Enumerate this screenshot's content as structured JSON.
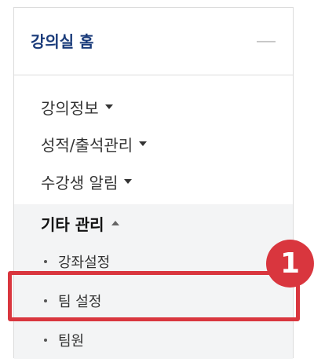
{
  "panel": {
    "title": "강의실 홈"
  },
  "menu": [
    {
      "label": "강의정보"
    },
    {
      "label": "성적/출석관리"
    },
    {
      "label": "수강생 알림"
    },
    {
      "label": "기타 관리"
    }
  ],
  "submenu": [
    {
      "label": "강좌설정"
    },
    {
      "label": "팀 설정"
    },
    {
      "label": "팀원"
    }
  ],
  "callout": {
    "number": "1"
  },
  "colors": {
    "title": "#1a3b7a",
    "highlight": "#d9363e",
    "submenu_bg": "#f3f4f5"
  }
}
